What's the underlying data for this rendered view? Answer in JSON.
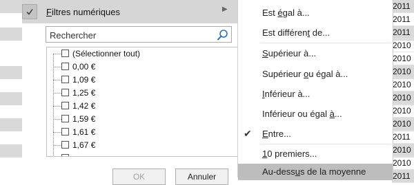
{
  "sheet": {
    "right_cells": [
      "2011",
      "2011",
      "2011",
      "2010",
      "2010",
      "2010",
      "2010",
      "2010",
      "2010",
      "2010",
      "2011",
      "2010",
      "2010",
      "2011"
    ]
  },
  "filter_panel": {
    "top_item": {
      "label_prefix": "",
      "label_mnemonic": "F",
      "label_rest": "iltres numériques",
      "checked": true
    },
    "search": {
      "placeholder": "Rechercher",
      "value": ""
    },
    "list": [
      "(Sélectionner tout)",
      "0,00 €",
      "1,09 €",
      "1,25 €",
      "1,42 €",
      "1,59 €",
      "1,61 €",
      "1,67 €"
    ],
    "buttons": {
      "ok": "OK",
      "cancel": "Annuler"
    }
  },
  "submenu": {
    "items": [
      {
        "pre": "Est ",
        "mn": "é",
        "post": "gal à..."
      },
      {
        "pre": "Est différen",
        "mn": "t",
        "post": " de..."
      },
      {
        "pre": "",
        "mn": "S",
        "post": "upérieur à..."
      },
      {
        "pre": "Supérieur ",
        "mn": "o",
        "post": "u égal à..."
      },
      {
        "pre": "",
        "mn": "I",
        "post": "nférieur à..."
      },
      {
        "pre": "Inférieur ou égal ",
        "mn": "à",
        "post": "..."
      },
      {
        "pre": "",
        "mn": "E",
        "post": "ntre...",
        "checked": true
      },
      {
        "pre": "",
        "mn": "1",
        "post": "0 premiers..."
      },
      {
        "pre": "Au-dess",
        "mn": "u",
        "post": "s de la moyenne",
        "highlighted": true
      }
    ]
  }
}
